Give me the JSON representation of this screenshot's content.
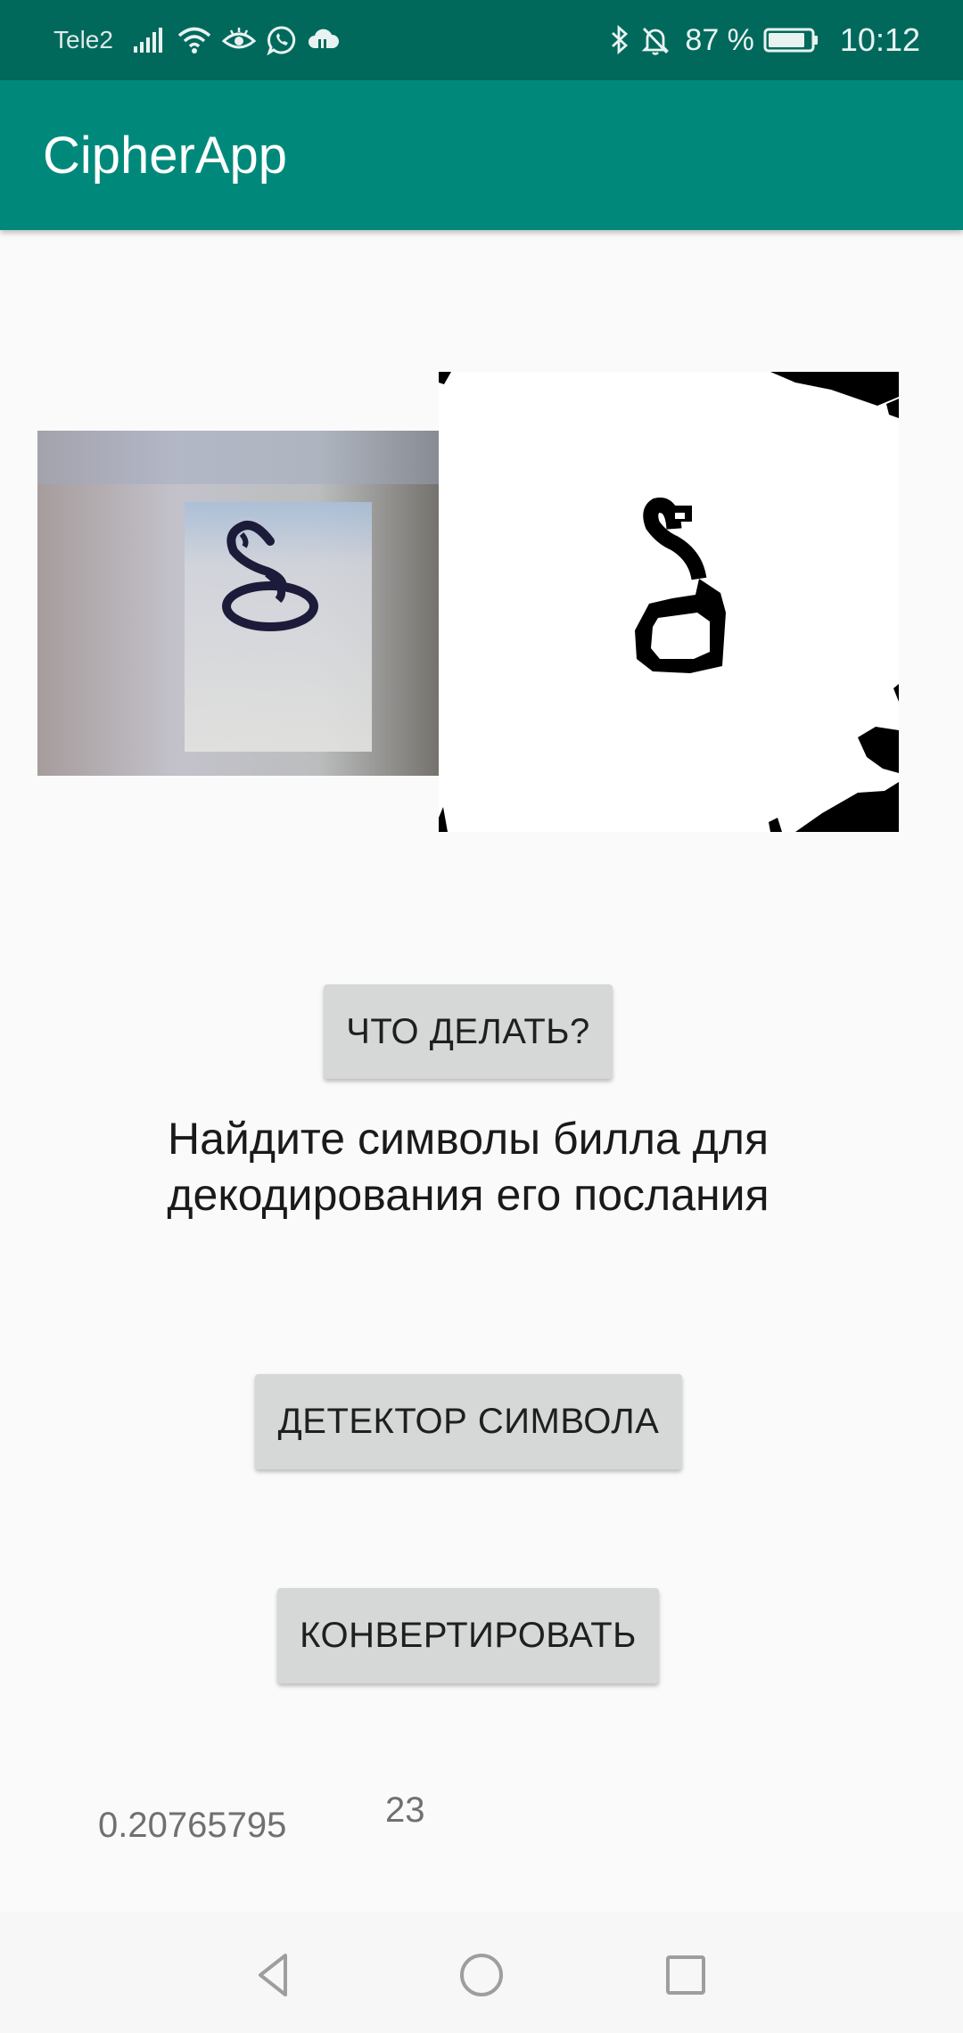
{
  "status_bar": {
    "carrier": "Tele2",
    "battery_percent": "87 %",
    "time": "10:12",
    "icons": [
      "signal-icon",
      "wifi-icon",
      "eye-icon",
      "whatsapp-icon",
      "cloud-icon",
      "bluetooth-icon",
      "bell-off-icon",
      "battery-icon"
    ]
  },
  "app_bar": {
    "title": "CipherApp"
  },
  "images": {
    "original": "original-photo-symbol",
    "processed": "binarized-photo-symbol"
  },
  "main": {
    "help_button": "ЧТО ДЕЛАТЬ?",
    "instruction": "Найдите символы билла для декодирования его послания",
    "detect_button": "ДЕТЕКТОР СИМВОЛА",
    "convert_button": "КОНВЕРТИРОВАТЬ",
    "probability": "0.20765795",
    "class_id": "23"
  },
  "nav_bar": {
    "icons": [
      "back-icon",
      "home-icon",
      "recents-icon"
    ]
  },
  "colors": {
    "status_bar": "#00695c",
    "app_bar": "#00897b",
    "background": "#fafafa",
    "button": "#d6d7d7"
  }
}
